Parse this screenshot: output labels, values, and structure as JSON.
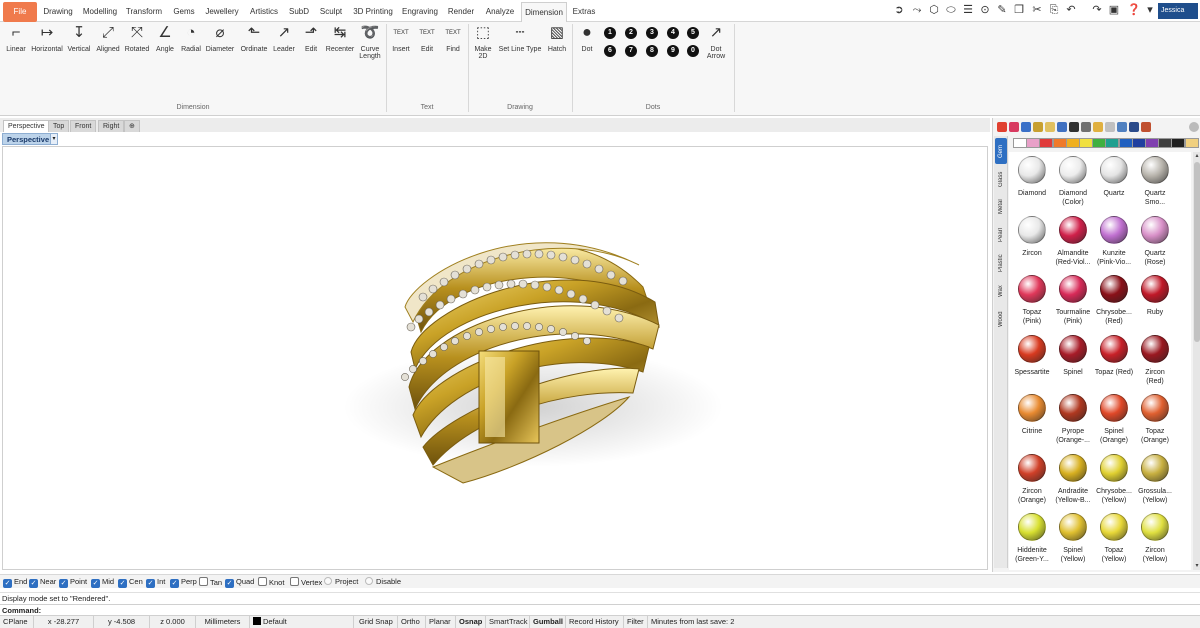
{
  "menu": {
    "tabs": [
      "File",
      "Drawing",
      "Modelling",
      "Transform",
      "Gems",
      "Jewellery",
      "Artistics",
      "SubD",
      "Sculpt",
      "3D Printing",
      "Engraving",
      "Render",
      "Analyze",
      "Dimension",
      "Extras"
    ],
    "active": "Dimension",
    "user": "Jessica"
  },
  "ribbon": {
    "dimension": {
      "label": "Dimension",
      "buttons": [
        "Linear",
        "Horizontal",
        "Vertical",
        "Aligned",
        "Rotated",
        "Angle",
        "Radial",
        "Diameter",
        "Ordinate",
        "Leader",
        "Edit",
        "Recenter",
        "Curve\nLength"
      ]
    },
    "text": {
      "label": "Text",
      "buttons": [
        "Insert",
        "Edit",
        "Find"
      ],
      "icon_texts": [
        "TEXT",
        "TEXT",
        "TEXT"
      ]
    },
    "drawing": {
      "label": "Drawing",
      "buttons": [
        "Make\n2D",
        "Set Line Type",
        "Hatch"
      ]
    },
    "dots": {
      "label": "Dots",
      "dot_label": "Dot",
      "numbers_row1": [
        "1",
        "2",
        "3",
        "4",
        "5"
      ],
      "numbers_row2": [
        "6",
        "7",
        "8",
        "9",
        "0"
      ],
      "arrow_label": "Dot\nArrow"
    }
  },
  "viewport": {
    "tabs": [
      "Perspective",
      "Top",
      "Front",
      "Right"
    ],
    "active_tab": "Perspective",
    "title": "Perspective"
  },
  "materials": {
    "side_tabs": [
      "Gem",
      "Glass",
      "Metal",
      "Pearl",
      "Plastic",
      "Wax",
      "Wood"
    ],
    "active_side_tab": "Gem",
    "swatches": [
      "#ffffff",
      "#e8a0c8",
      "#e03a3a",
      "#f07a2a",
      "#f0b020",
      "#f0e040",
      "#40b040",
      "#20a090",
      "#2060c0",
      "#2040a0",
      "#8040b0",
      "#404040",
      "#202020",
      "#f0d080"
    ],
    "gems": [
      {
        "name": "Diamond",
        "color": "#e8e8e8"
      },
      {
        "name": "Diamond\n(Color)",
        "color": "#ececec"
      },
      {
        "name": "Quartz",
        "color": "#e4e4e4"
      },
      {
        "name": "Quartz\nSmo...",
        "color": "#b8b4ac"
      },
      {
        "name": "Zircon",
        "color": "#e8e8e8"
      },
      {
        "name": "Almandite\n(Red-Viol...",
        "color": "#d0204a"
      },
      {
        "name": "Kunzite\n(Pink-Vio...",
        "color": "#c070d0"
      },
      {
        "name": "Quartz\n(Rose)",
        "color": "#d890c8"
      },
      {
        "name": "Topaz\n(Pink)",
        "color": "#e0385a"
      },
      {
        "name": "Tourmaline\n(Pink)",
        "color": "#d82a58"
      },
      {
        "name": "Chrysobe...\n(Red)",
        "color": "#8a1018"
      },
      {
        "name": "Ruby",
        "color": "#c01828"
      },
      {
        "name": "Spessartite",
        "color": "#d83a20"
      },
      {
        "name": "Spinel",
        "color": "#a81c28"
      },
      {
        "name": "Topaz (Red)",
        "color": "#c82028"
      },
      {
        "name": "Zircon\n(Red)",
        "color": "#9a1820"
      },
      {
        "name": "Citrine",
        "color": "#e88a30"
      },
      {
        "name": "Pyrope\n(Orange-...",
        "color": "#b03820"
      },
      {
        "name": "Spinel\n(Orange)",
        "color": "#e04828"
      },
      {
        "name": "Topaz\n(Orange)",
        "color": "#e06030"
      },
      {
        "name": "Zircon\n(Orange)",
        "color": "#d04028"
      },
      {
        "name": "Andradite\n(Yellow-B...",
        "color": "#d8b020"
      },
      {
        "name": "Chrysobe...\n(Yellow)",
        "color": "#e0d030"
      },
      {
        "name": "Grossula...\n(Yellow)",
        "color": "#c8b040"
      },
      {
        "name": "Hiddenite\n(Green-Y...",
        "color": "#d8e030"
      },
      {
        "name": "Spinel\n(Yellow)",
        "color": "#e0c030"
      },
      {
        "name": "Topaz\n(Yellow)",
        "color": "#e8d838"
      },
      {
        "name": "Zircon\n(Yellow)",
        "color": "#e0e040"
      }
    ]
  },
  "osnap": [
    {
      "label": "End",
      "checked": true
    },
    {
      "label": "Near",
      "checked": true
    },
    {
      "label": "Point",
      "checked": true
    },
    {
      "label": "Mid",
      "checked": true
    },
    {
      "label": "Cen",
      "checked": true
    },
    {
      "label": "Int",
      "checked": true
    },
    {
      "label": "Perp",
      "checked": true
    },
    {
      "label": "Tan",
      "checked": false
    },
    {
      "label": "Quad",
      "checked": true
    },
    {
      "label": "Knot",
      "checked": false
    },
    {
      "label": "Vertex",
      "checked": false
    },
    {
      "label": "Project",
      "radio": true
    },
    {
      "label": "Disable",
      "radio": true
    }
  ],
  "command": {
    "history": "Display mode set to \"Rendered\".",
    "prompt": "Command:",
    "value": ""
  },
  "status": {
    "cplane": "CPlane",
    "x": "x -28.277",
    "y": "y -4.508",
    "z": "z 0.000",
    "units": "Millimeters",
    "layer": "Default",
    "grid_snap": "Grid Snap",
    "ortho": "Ortho",
    "planar": "Planar",
    "osnap": "Osnap",
    "smarttrack": "SmartTrack",
    "gumball": "Gumball",
    "record_history": "Record History",
    "filter": "Filter",
    "save_info": "Minutes from last save: 2"
  },
  "colors": {
    "file_tab": "#f07a4c",
    "accent": "#2e6fc2",
    "gold": "#c9a227"
  }
}
